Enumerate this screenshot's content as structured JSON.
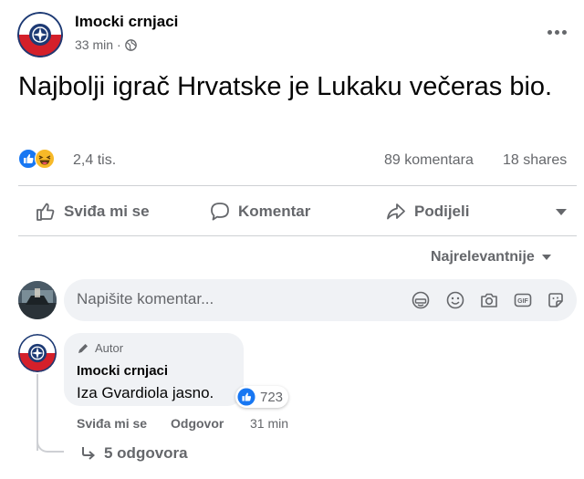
{
  "post": {
    "page_name": "Imocki crnjaci",
    "time": "33 min",
    "privacy_separator": "·",
    "text": "Najbolji igrač Hrvatske je Lukaku večeras bio."
  },
  "stats": {
    "reactions": "2,4 tis.",
    "comments": "89 komentara",
    "shares": "18 shares"
  },
  "actions": {
    "like": "Sviđa mi se",
    "comment": "Komentar",
    "share": "Podijeli"
  },
  "sort": {
    "label": "Najrelevantnije"
  },
  "composer": {
    "placeholder": "Napišite komentar...",
    "gif_label": "GIF"
  },
  "comment": {
    "badge": "Autor",
    "author": "Imocki crnjaci",
    "text": "Iza Gvardiola jasno.",
    "reactions": "723",
    "like": "Sviđa mi se",
    "reply": "Odgovor",
    "time": "31 min",
    "replies": "5 odgovora"
  },
  "colors": {
    "like_blue": "#1877f2",
    "haha_yellow": "#f7b928",
    "secondary_text": "#65676b",
    "logo_red": "#d4202a",
    "logo_navy": "#1d3a74"
  },
  "icons": [
    "page-logo-icon",
    "globe-icon",
    "more-icon",
    "like-reaction-icon",
    "haha-reaction-icon",
    "thumbs-up-icon",
    "comment-icon",
    "share-icon",
    "dropdown-caret-icon",
    "avatar-icon",
    "sticker-face-icon",
    "emoji-icon",
    "camera-icon",
    "gif-icon",
    "sticker-icon",
    "pencil-icon",
    "reply-arrow-icon"
  ]
}
